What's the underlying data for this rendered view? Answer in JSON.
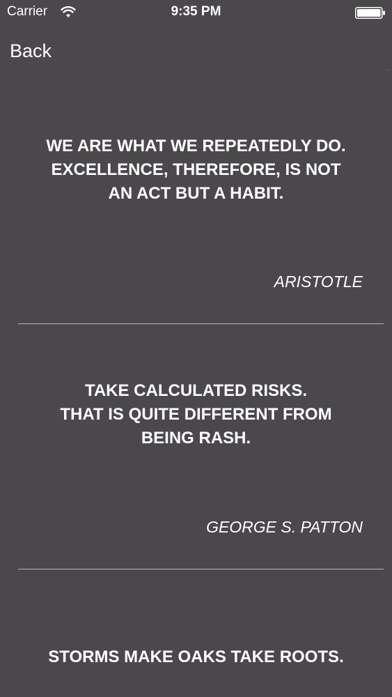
{
  "status_bar": {
    "carrier": "Carrier",
    "time": "9:35 PM",
    "wifi_icon": "wifi-icon",
    "battery_icon": "battery-icon"
  },
  "nav": {
    "back_label": "Back"
  },
  "quotes": [
    {
      "text": "WE ARE WHAT WE REPEATEDLY DO.\nEXCELLENCE, THEREFORE, IS NOT\nAN ACT BUT A HABIT.",
      "author": "ARISTOTLE"
    },
    {
      "text": "TAKE CALCULATED RISKS.\nTHAT IS QUITE DIFFERENT FROM\nBEING RASH.",
      "author": "GEORGE S. PATTON"
    },
    {
      "text": "STORMS MAKE OAKS TAKE ROOTS."
    }
  ],
  "colors": {
    "background": "#4a484b",
    "text": "#ffffff",
    "divider": "#b8b6b9"
  }
}
